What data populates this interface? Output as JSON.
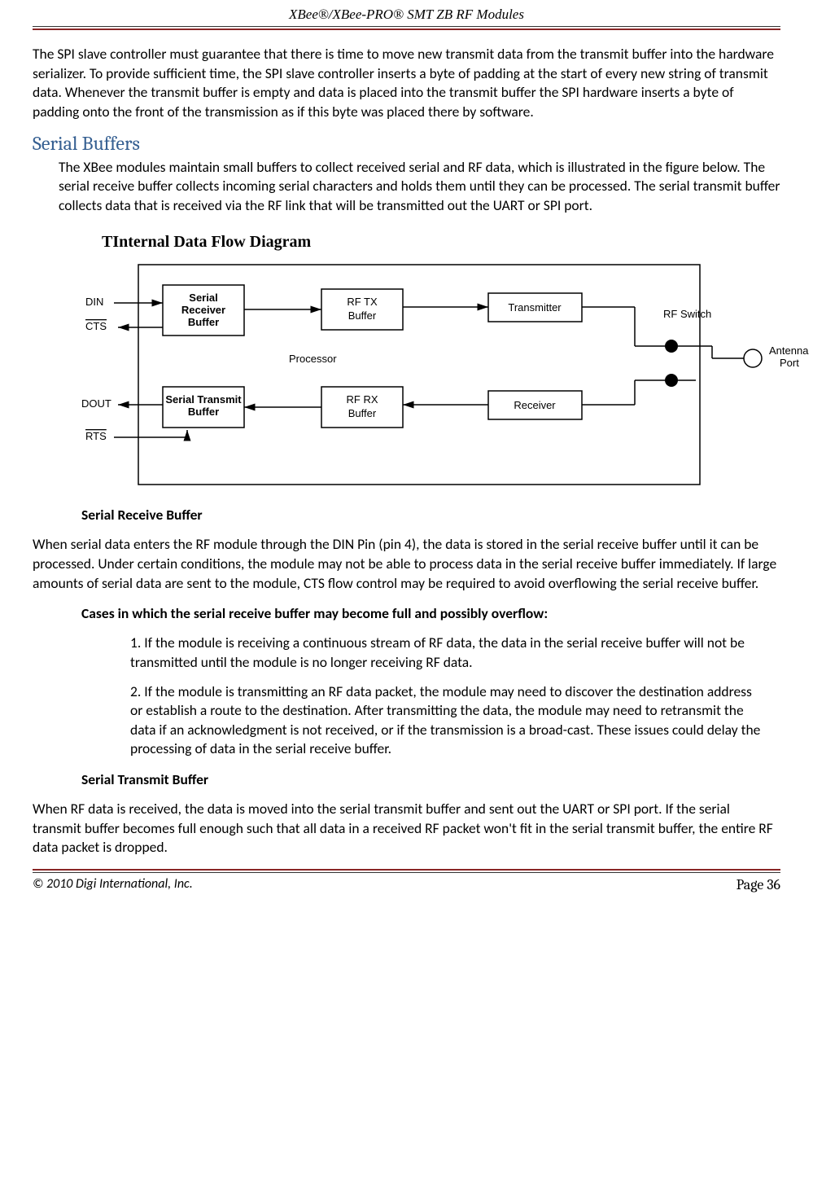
{
  "header": {
    "title": "XBee®/XBee-PRO® SMT ZB RF Modules"
  },
  "para1": "The SPI slave controller must guarantee that there is time to move new transmit data from the transmit buffer into the hardware serializer. To provide sufficient time, the SPI slave controller inserts a byte of padding at the start of every new string of transmit data. Whenever the transmit buffer is empty and data is placed into the transmit buffer the SPI hardware inserts a byte of padding onto the front of the transmission as if this byte was placed there by software.",
  "section_heading": "Serial Buffers",
  "para2": "The XBee modules maintain small buffers to collect received serial and RF data, which is illustrated in the figure below. The serial receive buffer collects incoming serial characters and holds them until they can be processed. The serial transmit buffer collects data that is received via the RF link that will be transmitted out the UART or SPI port.",
  "diagram": {
    "title": "TInternal Data Flow Diagram",
    "labels": {
      "din": "DIN",
      "cts": "CTS",
      "dout": "DOUT",
      "rts": "RTS",
      "srb": "Serial Receiver Buffer",
      "stb": "Serial Transmit Buffer",
      "processor": "Processor",
      "rftx": "RF TX Buffer",
      "rfrx": "RF RX Buffer",
      "transmitter": "Transmitter",
      "receiver": "Receiver",
      "rfswitch": "RF Switch",
      "antenna": "Antenna Port"
    }
  },
  "sub1": "Serial Receive Buffer",
  "para3": "When serial data enters the RF module through the DIN Pin (pin 4), the data is stored in the serial receive buffer until it can be processed. Under certain conditions, the module may not be able to process data in the serial receive buffer immediately. If large amounts of serial data are sent to the module, CTS flow control may be required to avoid overflowing the serial receive buffer.",
  "sub2": "Cases in which the serial receive buffer may become full and possibly overflow:",
  "case1": "1. If the module is receiving a continuous stream of RF data, the data in the serial receive buffer will not be transmitted until the module is no longer receiving RF data.",
  "case2": "2. If the module is transmitting an RF data packet, the module may need to discover the destination address or establish a route to the destination. After transmitting the data, the module may need to retransmit the data if an acknowledgment is not received, or if the transmission is a broad-cast. These issues could delay the processing of data in the serial receive buffer.",
  "sub3": "Serial Transmit Buffer",
  "para4": "When RF data is received, the data is moved into the serial transmit buffer and sent out the UART or SPI port. If the serial transmit buffer becomes full enough such that all data in a received RF packet won't fit in the serial transmit buffer, the entire RF data packet is dropped.",
  "footer": {
    "left": "© 2010 Digi International, Inc.",
    "right_prefix": "Page ",
    "right_num": "36"
  }
}
